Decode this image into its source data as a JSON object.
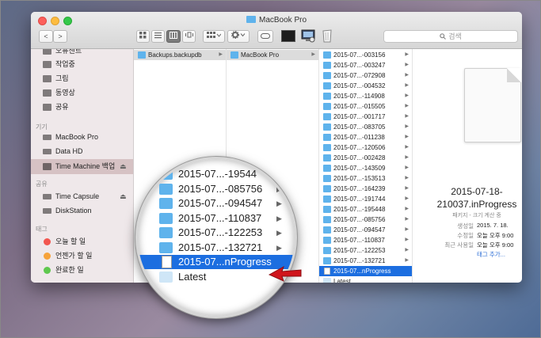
{
  "window": {
    "title": "MacBook Pro"
  },
  "toolbar": {
    "back": "<",
    "forward": ">",
    "search_placeholder": "검색"
  },
  "sidebar": {
    "top_items": [
      {
        "label": "오퓨센트"
      },
      {
        "label": "작업중"
      },
      {
        "label": "그림"
      },
      {
        "label": "동영상"
      },
      {
        "label": "공유"
      }
    ],
    "devices_header": "기기",
    "devices": [
      {
        "label": "MacBook Pro"
      },
      {
        "label": "Data HD"
      },
      {
        "label": "Time Machine 백업",
        "eject": "⏏"
      }
    ],
    "shared_header": "공유",
    "shared": [
      {
        "label": "Time Capsule",
        "eject": "⏏"
      },
      {
        "label": "DiskStation"
      }
    ],
    "tags_header": "태그",
    "tags": [
      {
        "label": "오늘 할 일",
        "color": "#f2564f"
      },
      {
        "label": "언젠가 할 일",
        "color": "#f6a23a"
      },
      {
        "label": "완료한 일",
        "color": "#5fc84e"
      }
    ]
  },
  "column1": {
    "items": [
      {
        "label": "Backups.backupdb"
      }
    ]
  },
  "column2": {
    "items": [
      {
        "label": "MacBook Pro"
      }
    ]
  },
  "column3": {
    "items": [
      {
        "label": "2015-07...-003156"
      },
      {
        "label": "2015-07...-003247"
      },
      {
        "label": "2015-07...-072908"
      },
      {
        "label": "2015-07...-004532"
      },
      {
        "label": "2015-07...-114908"
      },
      {
        "label": "2015-07...-015505"
      },
      {
        "label": "2015-07...-001717"
      },
      {
        "label": "2015-07...-083705"
      },
      {
        "label": "2015-07...-011238"
      },
      {
        "label": "2015-07...-120506"
      },
      {
        "label": "2015-07...-002428"
      },
      {
        "label": "2015-07...-143509"
      },
      {
        "label": "2015-07...-153513"
      },
      {
        "label": "2015-07...-164239"
      },
      {
        "label": "2015-07...-191744"
      },
      {
        "label": "2015-07...-195448"
      },
      {
        "label": "2015-07...-085756"
      },
      {
        "label": "2015-07...-094547"
      },
      {
        "label": "2015-07...-110837"
      },
      {
        "label": "2015-07...-122253"
      },
      {
        "label": "2015-07...-132721"
      },
      {
        "label": "2015-07...nProgress",
        "selected": true
      },
      {
        "label": "Latest",
        "alias": true
      }
    ]
  },
  "preview": {
    "name": "2015-07-18-210037.inProgress",
    "kind": "패키지 - 크기 계산 중",
    "created_label": "생성일",
    "created_value": "2015. 7. 18.",
    "modified_label": "수정일",
    "modified_value": "오늘 오후 9:00",
    "opened_label": "최근 사용일",
    "opened_value": "오늘 오후 9:00",
    "tags_link": "태그 추가..."
  },
  "magnifier": {
    "rows": [
      {
        "label": "2015-07...-19544"
      },
      {
        "label": "2015-07...-085756"
      },
      {
        "label": "2015-07...-094547"
      },
      {
        "label": "2015-07...-110837"
      },
      {
        "label": "2015-07...-122253"
      },
      {
        "label": "2015-07...-132721"
      },
      {
        "label": "2015-07...nProgress",
        "selected": true
      },
      {
        "label": "Latest",
        "alias": true
      }
    ]
  }
}
